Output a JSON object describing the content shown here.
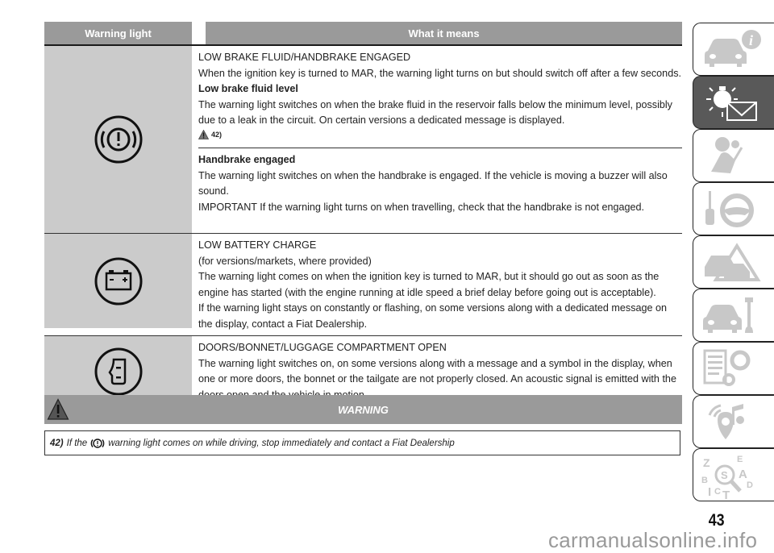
{
  "table": {
    "headers": [
      "Warning light",
      "What it means"
    ],
    "rows": [
      {
        "icon": "brake-warning-icon",
        "sections": [
          {
            "lines": [
              {
                "text": "LOW BRAKE FLUID/HANDBRAKE ENGAGED",
                "bold": false
              },
              {
                "text": "When the ignition key is turned to MAR, the warning light turns on but should switch off after a few seconds.",
                "bold": false
              },
              {
                "text": "Low brake fluid level",
                "bold": true
              },
              {
                "text": "The warning light switches on when the brake fluid in the reservoir falls below the minimum level, possibly due to a leak in the circuit. On certain versions a dedicated message is displayed.",
                "bold": false
              }
            ],
            "reference": "42)"
          },
          {
            "lines": [
              {
                "text": "Handbrake engaged",
                "bold": true
              },
              {
                "text": "The warning light switches on when the handbrake is engaged. If the vehicle is moving a buzzer will also sound.",
                "bold": false
              },
              {
                "text": "IMPORTANT If the warning light turns on when travelling, check that the handbrake is not engaged.",
                "bold": false
              }
            ]
          }
        ]
      },
      {
        "icon": "battery-icon",
        "sections": [
          {
            "lines": [
              {
                "text": "LOW BATTERY CHARGE",
                "bold": false
              },
              {
                "text": "(for versions/markets, where provided)",
                "bold": false
              },
              {
                "text": "The warning light comes on when the ignition key is turned to MAR, but it should go out as soon as the engine has started (with the engine running at idle speed a brief delay before going out is acceptable).",
                "bold": false
              },
              {
                "text": "If the warning light stays on constantly or flashing, on some versions along with a dedicated message on the display, contact a Fiat Dealership.",
                "bold": false
              }
            ]
          }
        ]
      },
      {
        "icon": "door-open-icon",
        "sections": [
          {
            "lines": [
              {
                "text": "DOORS/BONNET/LUGGAGE COMPARTMENT OPEN",
                "bold": false
              },
              {
                "text": "The warning light switches on, on some versions along with a message and a symbol in the display, when one or more doors, the bonnet or the tailgate are not properly closed. An acoustic signal is emitted with the doors open and the vehicle in motion.",
                "bold": false
              }
            ]
          }
        ]
      }
    ]
  },
  "warning": {
    "title": "WARNING",
    "note_number": "42)",
    "note_before": "If the",
    "note_after": "warning light comes on while driving, stop immediately and contact a Fiat Dealership"
  },
  "sidebar": {
    "tabs": [
      {
        "name": "knowing-your-car",
        "icon": "car-info-icon",
        "active": false
      },
      {
        "name": "warning-lights-messages",
        "icon": "light-message-icon",
        "active": true
      },
      {
        "name": "safety",
        "icon": "airbag-seatbelt-icon",
        "active": false
      },
      {
        "name": "starting-driving",
        "icon": "key-steering-icon",
        "active": false
      },
      {
        "name": "in-an-emergency",
        "icon": "car-warning-triangle-icon",
        "active": false
      },
      {
        "name": "maintenance-care",
        "icon": "car-wrench-icon",
        "active": false
      },
      {
        "name": "technical-data",
        "icon": "list-gears-icon",
        "active": false
      },
      {
        "name": "multimedia",
        "icon": "music-location-icon",
        "active": false
      },
      {
        "name": "index",
        "icon": "alphabet-search-icon",
        "active": false
      }
    ]
  },
  "page_number": "43",
  "watermark": "carmanualsonline.info"
}
